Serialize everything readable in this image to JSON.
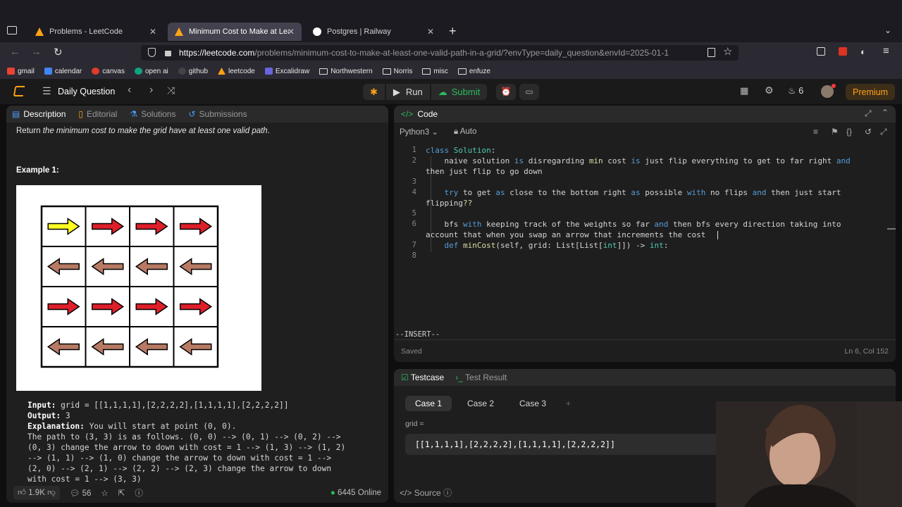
{
  "browser": {
    "tabs": [
      {
        "title": "Problems - LeetCode",
        "icon": "leetcode-icon",
        "active": false
      },
      {
        "title": "Minimum Cost to Make at Least",
        "icon": "leetcode-icon",
        "active": true
      },
      {
        "title": "Postgres | Railway",
        "icon": "railway-icon",
        "active": false
      }
    ],
    "url_host": "https://leetcode.com",
    "url_path": "/problems/minimum-cost-to-make-at-least-one-valid-path-in-a-grid/?envType=daily_question&envId=2025-01-1",
    "bookmarks": [
      "gmail",
      "calendar",
      "canvas",
      "open ai",
      "github",
      "leetcode",
      "Excalidraw",
      "Northwestern",
      "Norris",
      "misc",
      "enfuze"
    ]
  },
  "header": {
    "title": "Daily Question",
    "run_label": "Run",
    "submit_label": "Submit",
    "streak_count": "6",
    "premium_label": "Premium"
  },
  "left": {
    "tabs": [
      "Description",
      "Editorial",
      "Solutions",
      "Submissions"
    ],
    "return_text_pre": "Return",
    "return_text_em": "the minimum cost to make the grid have at least one valid path",
    "return_text_post": ".",
    "example_heading": "Example 1:",
    "input_label": "Input:",
    "input_value": " grid = [[1,1,1,1],[2,2,2,2],[1,1,1,1],[2,2,2,2]]",
    "output_label": "Output:",
    "output_value": " 3",
    "explanation_label": "Explanation:",
    "explanation_lines": [
      " You will start at point (0, 0).",
      "The path to (3, 3) is as follows. (0, 0) --> (0, 1) --> (0, 2) -->",
      "(0, 3) change the arrow to down with cost = 1 --> (1, 3) --> (1, 2)",
      "--> (1, 1) --> (1, 0) change the arrow to down with cost = 1 -->",
      "(2, 0) --> (2, 1) --> (2, 2) --> (2, 3) change the arrow to down",
      "with cost = 1 --> (3, 3)"
    ],
    "grid_arrows": [
      [
        "right-yellow",
        "right-red",
        "right-red",
        "right-red"
      ],
      [
        "left-brown",
        "left-brown",
        "left-brown",
        "left-brown"
      ],
      [
        "right-red",
        "right-red",
        "right-red",
        "right-red"
      ],
      [
        "left-brown",
        "left-brown",
        "left-brown",
        "left-brown"
      ]
    ],
    "likes": "1.9K",
    "comments": "56",
    "online": "6445 Online"
  },
  "code": {
    "title": "Code",
    "language": "Python3",
    "mode": "Auto",
    "line_numbers": [
      "1",
      "2",
      "",
      "3",
      "4",
      "",
      "5",
      "6",
      "",
      "7",
      "8"
    ],
    "insert_mode": "--INSERT--",
    "saved": "Saved",
    "cursor_pos": "Ln 6, Col 152"
  },
  "testcase": {
    "tab_testcase": "Testcase",
    "tab_result": "Test Result",
    "cases": [
      "Case 1",
      "Case 2",
      "Case 3"
    ],
    "add": "+",
    "var_label": "grid =",
    "var_value": "[[1,1,1,1],[2,2,2,2],[1,1,1,1],[2,2,2,2]]",
    "source_label": "Source"
  },
  "colors": {
    "accent_orange": "#ffa116",
    "submit_green": "#2cbb5d",
    "arrow_red": "#dd1f2a",
    "arrow_yellow": "#ffff22",
    "arrow_brown": "#b87a64"
  }
}
